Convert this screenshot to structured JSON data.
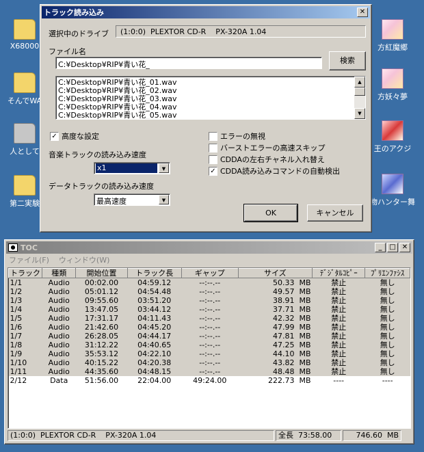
{
  "desktop": {
    "icons_left": [
      {
        "label": "X68000"
      },
      {
        "label": "そんでWA"
      },
      {
        "label": "人として"
      },
      {
        "label": "第二実験"
      }
    ],
    "icons_right": [
      {
        "label": "方紅魔郷"
      },
      {
        "label": "方妖々夢"
      },
      {
        "label": "王のアクジ"
      },
      {
        "label": "物ハンター舞"
      }
    ]
  },
  "dialog": {
    "title": "トラック読み込み",
    "close_glyph": "✕",
    "drive_label": "選択中のドライブ",
    "drive_value": "(1:0:0)  PLEXTOR CD-R    PX-320A 1.04",
    "file_label": "ファイル名",
    "file_value": "C:¥Desktop¥RIP¥青い花_",
    "search_button": "検索",
    "file_list": [
      "C:¥Desktop¥RIP¥青い花_01.wav",
      "C:¥Desktop¥RIP¥青い花_02.wav",
      "C:¥Desktop¥RIP¥青い花_03.wav",
      "C:¥Desktop¥RIP¥青い花_04.wav",
      "C:¥Desktop¥RIP¥青い花_05.wav"
    ],
    "advanced_label": "高度な設定",
    "advanced_checked": true,
    "music_speed_label": "音楽トラックの読み込み速度",
    "music_speed_value": "x1",
    "data_speed_label": "データトラックの読み込み速度",
    "data_speed_value": "最高速度",
    "options": [
      {
        "label": "エラーの無視",
        "checked": false
      },
      {
        "label": "バーストエラーの高速スキップ",
        "checked": false
      },
      {
        "label": "CDDAの左右チャネル入れ替え",
        "checked": false
      },
      {
        "label": "CDDA読み込みコマンドの自動検出",
        "checked": true
      }
    ],
    "ok_button": "OK",
    "cancel_button": "キャンセル"
  },
  "toc": {
    "title": "TOC",
    "menu": [
      "ファイル(F)",
      "ウィンドウ(W)"
    ],
    "columns": [
      "トラック",
      "種類",
      "開始位置",
      "トラック長",
      "ギャップ",
      "サイズ",
      "ﾃﾞｼﾞﾀﾙｺﾋﾟｰ",
      "ﾌﾟﾘｴﾝﾌｧｼｽ"
    ],
    "rows": [
      [
        "1/1",
        "Audio",
        "00:02.00",
        "04:59.12",
        "--:--.--",
        "50.33  MB",
        "禁止",
        "無し"
      ],
      [
        "1/2",
        "Audio",
        "05:01.12",
        "04:54.48",
        "--:--.--",
        "49.57  MB",
        "禁止",
        "無し"
      ],
      [
        "1/3",
        "Audio",
        "09:55.60",
        "03:51.20",
        "--:--.--",
        "38.91  MB",
        "禁止",
        "無し"
      ],
      [
        "1/4",
        "Audio",
        "13:47.05",
        "03:44.12",
        "--:--.--",
        "37.71  MB",
        "禁止",
        "無し"
      ],
      [
        "1/5",
        "Audio",
        "17:31.17",
        "04:11.43",
        "--:--.--",
        "42.32  MB",
        "禁止",
        "無し"
      ],
      [
        "1/6",
        "Audio",
        "21:42.60",
        "04:45.20",
        "--:--.--",
        "47.99  MB",
        "禁止",
        "無し"
      ],
      [
        "1/7",
        "Audio",
        "26:28.05",
        "04:44.17",
        "--:--.--",
        "47.81  MB",
        "禁止",
        "無し"
      ],
      [
        "1/8",
        "Audio",
        "31:12.22",
        "04:40.65",
        "--:--.--",
        "47.25  MB",
        "禁止",
        "無し"
      ],
      [
        "1/9",
        "Audio",
        "35:53.12",
        "04:22.10",
        "--:--.--",
        "44.10  MB",
        "禁止",
        "無し"
      ],
      [
        "1/10",
        "Audio",
        "40:15.22",
        "04:20.38",
        "--:--.--",
        "43.82  MB",
        "禁止",
        "無し"
      ],
      [
        "1/11",
        "Audio",
        "44:35.60",
        "04:48.15",
        "--:--.--",
        "48.48  MB",
        "禁止",
        "無し"
      ],
      [
        "2/12",
        "Data",
        "51:56.00",
        "22:04.00",
        "49:24.00",
        "222.73  MB",
        "----",
        "----"
      ]
    ],
    "status_drive": "(1:0:0)  PLEXTOR CD-R    PX-320A 1.04",
    "status_total_length": "全長  73:58.00",
    "status_total_size": "746.60  MB"
  }
}
